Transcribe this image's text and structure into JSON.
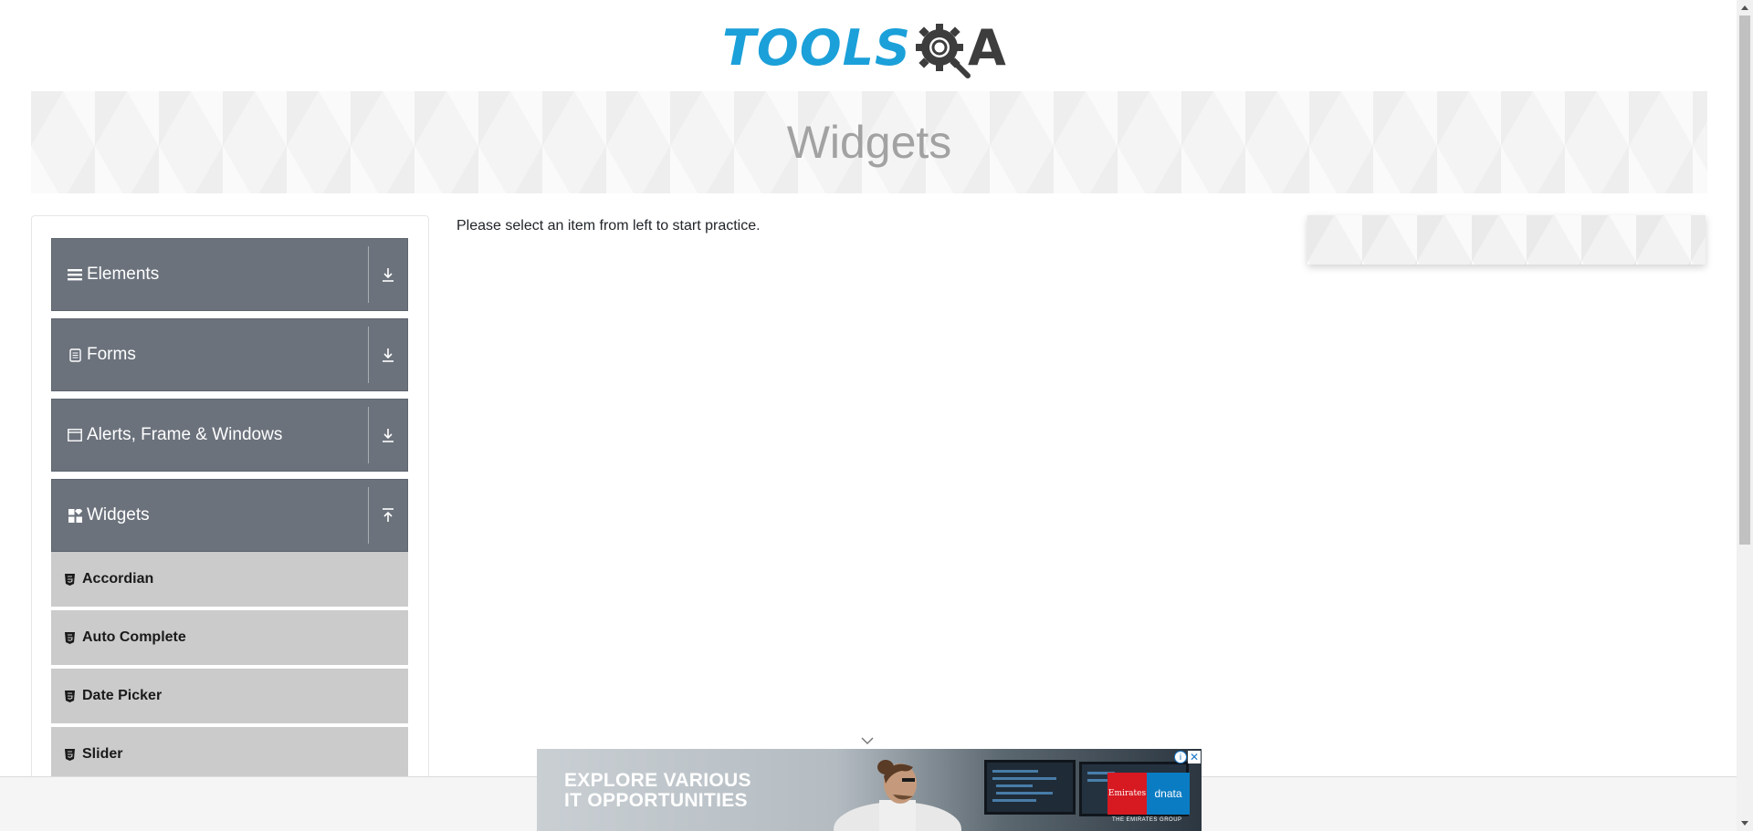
{
  "header": {
    "logo_tools": "TOOLS",
    "logo_a": "A"
  },
  "banner": {
    "title": "Widgets"
  },
  "sidebar": {
    "groups": [
      {
        "label": "Elements",
        "icon": "menu-icon",
        "state": "collapsed"
      },
      {
        "label": "Forms",
        "icon": "document-icon",
        "state": "collapsed"
      },
      {
        "label": "Alerts, Frame & Windows",
        "icon": "window-icon",
        "state": "collapsed"
      },
      {
        "label": "Widgets",
        "icon": "widgets-icon",
        "state": "expanded"
      }
    ],
    "widget_items": [
      {
        "label": "Accordian",
        "icon": "html5-icon"
      },
      {
        "label": "Auto Complete",
        "icon": "html5-icon"
      },
      {
        "label": "Date Picker",
        "icon": "html5-icon"
      },
      {
        "label": "Slider",
        "icon": "html5-icon"
      }
    ]
  },
  "main": {
    "prompt": "Please select an item from left to start practice."
  },
  "ad": {
    "headline_line1": "EXPLORE VARIOUS",
    "headline_line2": "IT OPPORTUNITIES",
    "brand_1": "Emirates",
    "brand_2": "dnata",
    "brand_group": "THE EMIRATES GROUP",
    "info_symbol": "i",
    "close_symbol": "✕"
  },
  "colors": {
    "logo_blue": "#1ba0d9",
    "logo_dark": "#3d3d3d",
    "group_bg": "#6b727c",
    "item_bg": "#cbcbcb",
    "banner_title": "#a2a2a2"
  }
}
